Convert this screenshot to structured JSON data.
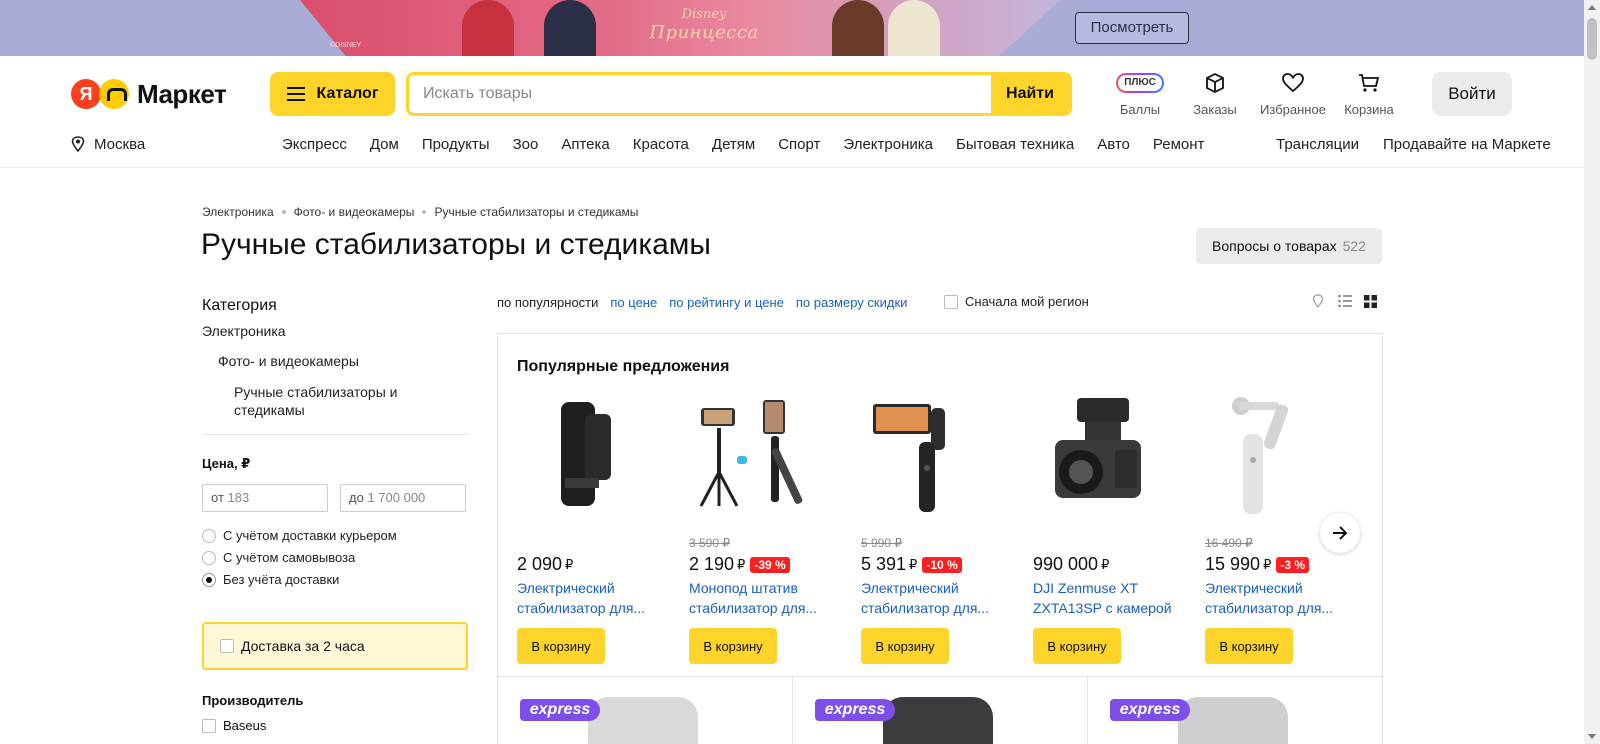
{
  "banner": {
    "brand_line1": "Disney",
    "brand_line2": "Принцесса",
    "copyright": "©DISNEY",
    "button": "Посмотреть"
  },
  "header": {
    "logo_ya": "Я",
    "logo_text": "Маркет",
    "catalog_label": "Каталог",
    "search_placeholder": "Искать товары",
    "search_button": "Найти",
    "icons": [
      {
        "icon": "plus-badge-icon",
        "badge": "ПЛЮС",
        "label": "Баллы"
      },
      {
        "icon": "box-icon",
        "label": "Заказы"
      },
      {
        "icon": "heart-icon",
        "label": "Избранное"
      },
      {
        "icon": "cart-icon",
        "label": "Корзина"
      }
    ],
    "login": "Войти",
    "city": "Москва",
    "categories": [
      "Экспресс",
      "Дом",
      "Продукты",
      "Зоо",
      "Аптека",
      "Красота",
      "Детям",
      "Спорт",
      "Электроника",
      "Бытовая техника",
      "Авто",
      "Ремонт"
    ],
    "right_links": [
      "Трансляции",
      "Продавайте на Маркете"
    ]
  },
  "breadcrumbs": [
    "Электроника",
    "Фото- и видеокамеры",
    "Ручные стабилизаторы и стедикамы"
  ],
  "page_title": "Ручные стабилизаторы и стедикамы",
  "questions": {
    "label": "Вопросы о товарах",
    "count": "522"
  },
  "filters": {
    "category_title": "Категория",
    "category_tree": [
      "Электроника",
      "Фото- и видеокамеры",
      "Ручные стабилизаторы и стедикамы"
    ],
    "price_title": "Цена, ₽",
    "price_from_prefix": "от",
    "price_from": "183",
    "price_to_prefix": "до",
    "price_to": "1 700 000",
    "delivery_options": [
      {
        "label": "С учётом доставки курьером",
        "selected": false
      },
      {
        "label": "С учётом самовывоза",
        "selected": false
      },
      {
        "label": "Без учёта доставки",
        "selected": true
      }
    ],
    "express_label": "Доставка за 2 часа",
    "manufacturer_title": "Производитель",
    "manufacturers": [
      "Baseus"
    ]
  },
  "sort": {
    "current": "по популярности",
    "options": [
      "по цене",
      "по рейтингу и цене",
      "по размеру скидки"
    ],
    "region_label": "Сначала мой регион"
  },
  "popular": {
    "title": "Популярные предложения",
    "buy_label": "В корзину",
    "currency": "₽",
    "items": [
      {
        "old_price": "",
        "price": "2 090",
        "discount": "",
        "name": "Электрический стабилизатор для..."
      },
      {
        "old_price": "3 590 ₽",
        "price": "2 190",
        "discount": "-39 %",
        "name": "Монопод штатив стабилизатор для..."
      },
      {
        "old_price": "5 990 ₽",
        "price": "5 391",
        "discount": "-10 %",
        "name": "Электрический стабилизатор для..."
      },
      {
        "old_price": "",
        "price": "990 000",
        "discount": "",
        "name": "DJI Zenmuse XT ZXTA13SP с камерой"
      },
      {
        "old_price": "16 490 ₽",
        "price": "15 990",
        "discount": "-3 %",
        "name": "Электрический стабилизатор для..."
      }
    ]
  },
  "grid_badge": "express",
  "colors": {
    "accent": "#fed42b",
    "link": "#1a5ec7",
    "discount": "#ff1f1f",
    "express": "#7d4ee8"
  }
}
